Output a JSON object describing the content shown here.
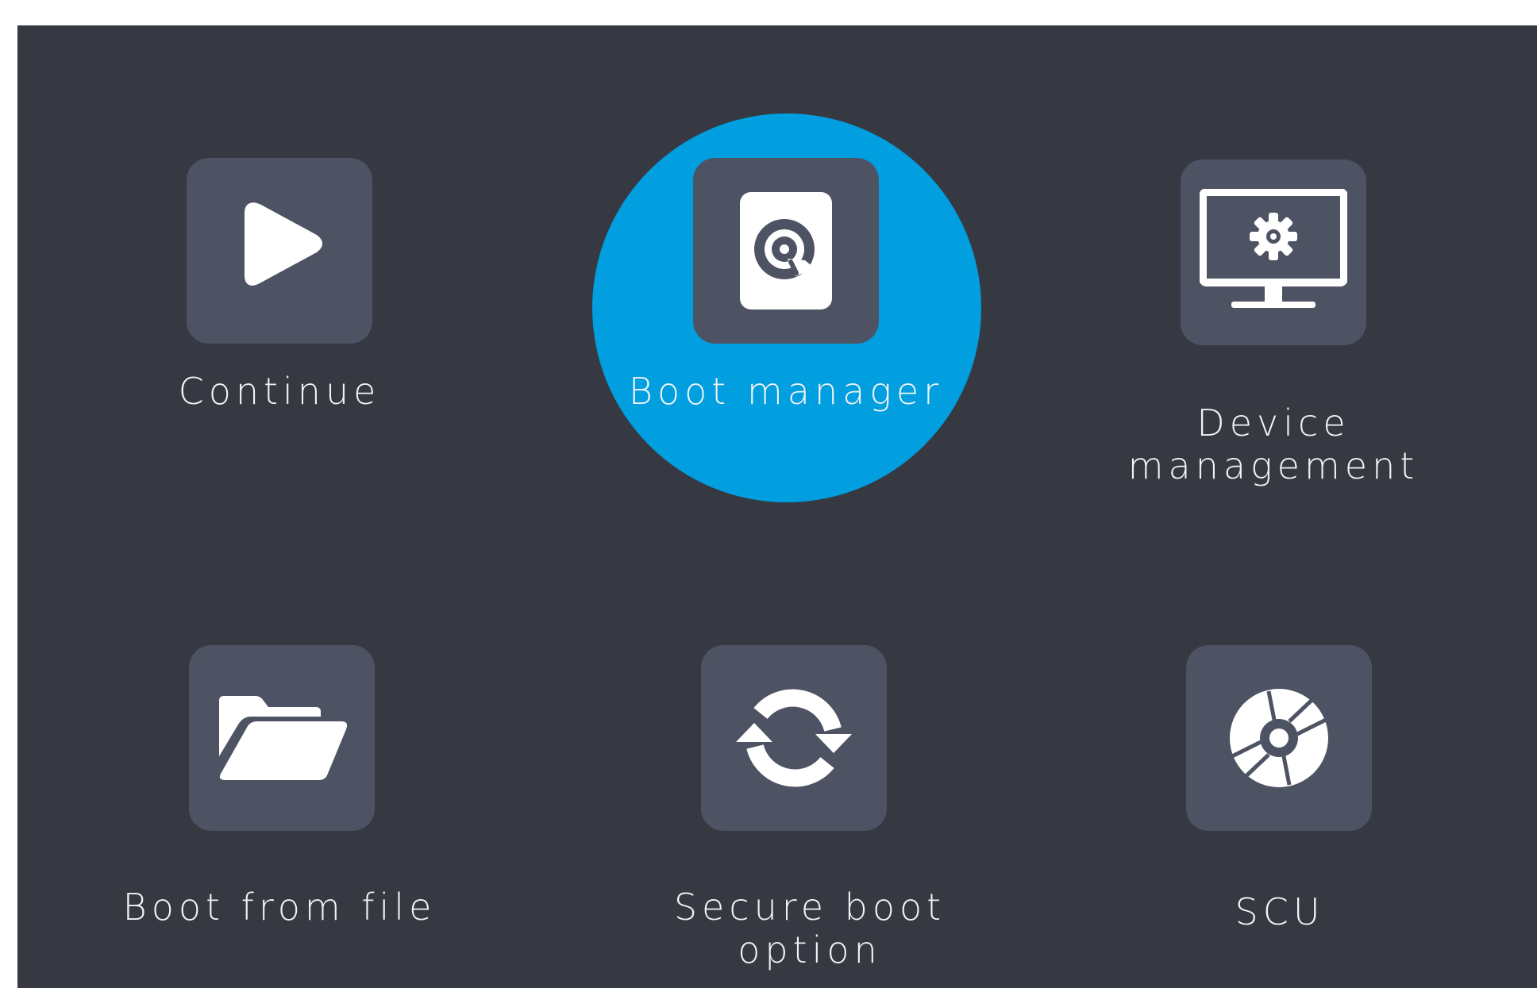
{
  "colors": {
    "background": "#363942",
    "tile": "#4e5363",
    "selected_highlight": "#019ee0",
    "text": "#f2f3f5",
    "outer_border": "#ffffff"
  },
  "menu": {
    "selected_index": 1,
    "items": [
      {
        "id": "continue",
        "label": "Continue",
        "icon": "play-icon"
      },
      {
        "id": "boot-manager",
        "label": "Boot manager",
        "icon": "hard-disk-icon"
      },
      {
        "id": "device-management",
        "label": "Device management",
        "icon": "monitor-gear-icon"
      },
      {
        "id": "boot-from-file",
        "label": "Boot from file",
        "icon": "folder-open-icon"
      },
      {
        "id": "secure-boot-option",
        "label": "Secure boot option",
        "icon": "refresh-icon"
      },
      {
        "id": "scu",
        "label": "SCU",
        "icon": "disc-icon"
      }
    ]
  }
}
